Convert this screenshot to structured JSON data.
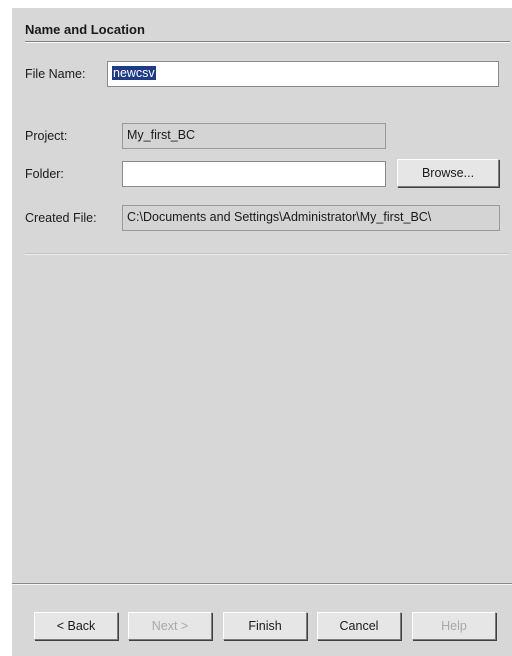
{
  "section": {
    "title": "Name and Location"
  },
  "form": {
    "file_name": {
      "label": "File Name:",
      "value": "newcsv"
    },
    "project": {
      "label": "Project:",
      "value": "My_first_BC"
    },
    "folder": {
      "label": "Folder:",
      "value": ""
    },
    "created_file": {
      "label": "Created File:",
      "value": "C:\\Documents and Settings\\Administrator\\My_first_BC\\"
    },
    "browse_label": "Browse..."
  },
  "buttons": {
    "back": "< Back",
    "next": "Next >",
    "finish": "Finish",
    "cancel": "Cancel",
    "help": "Help"
  },
  "state": {
    "next_enabled": false,
    "help_enabled": false
  }
}
